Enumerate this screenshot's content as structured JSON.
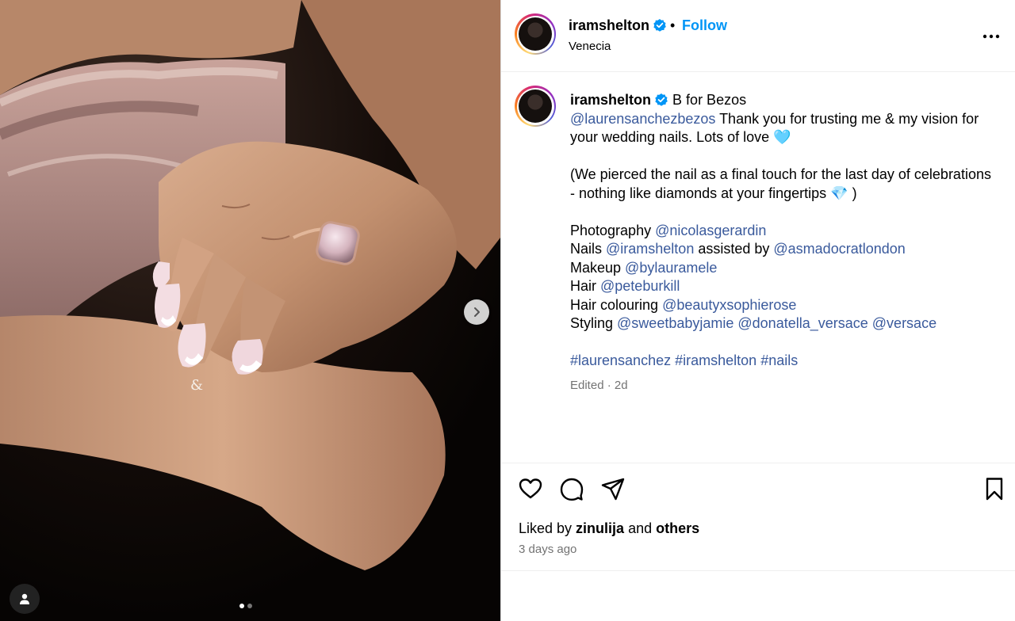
{
  "post": {
    "author": "iramshelton",
    "location": "Venecia",
    "follow_label": "Follow",
    "separator": "•"
  },
  "caption": {
    "username": "iramshelton",
    "headline": "B for Bezos",
    "line1_mention": "@laurensanchezbezos",
    "line1_text": " Thank you for trusting me & my vision for your wedding nails. Lots of love 🩵",
    "paragraph2": "(We pierced the nail as a final touch for the last day of celebrations - nothing like diamonds at your fingertips 💎 )",
    "credits": [
      {
        "label": "Photography ",
        "mentions": [
          "@nicolasgerardin"
        ]
      },
      {
        "label": "Nails ",
        "mentions": [
          "@iramshelton"
        ],
        "middle": " assisted by ",
        "mentions2": [
          "@asmadocratlondon"
        ]
      },
      {
        "label": "Makeup ",
        "mentions": [
          "@bylauramele"
        ]
      },
      {
        "label": "Hair ",
        "mentions": [
          "@peteburkill"
        ]
      },
      {
        "label": "Hair colouring ",
        "mentions": [
          "@beautyxsophierose"
        ]
      },
      {
        "label": "Styling ",
        "mentions": [
          "@sweetbabyjamie",
          "@donatella_versace",
          "@versace"
        ]
      }
    ],
    "hashtags": [
      "#laurensanchez",
      "#iramshelton",
      "#nails"
    ],
    "edited": "Edited · 2d"
  },
  "engagement": {
    "liked_by_prefix": "Liked by ",
    "liked_by_user": "zinulija",
    "liked_by_mid": " and ",
    "liked_by_others": "others",
    "time_ago": "3 days ago"
  },
  "carousel": {
    "count": 2,
    "active": 0
  },
  "icons": {
    "verified": "verified-badge-icon",
    "more": "more-options-icon",
    "like": "heart-icon",
    "comment": "comment-icon",
    "share": "share-icon",
    "save": "bookmark-icon",
    "next": "chevron-right-icon",
    "tags": "user-tag-icon"
  },
  "colors": {
    "link": "#3a5a9c",
    "follow": "#0095f6",
    "verified": "#0095f6",
    "muted": "#737373"
  }
}
